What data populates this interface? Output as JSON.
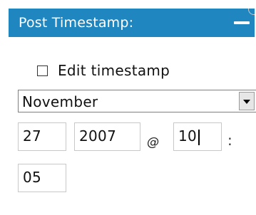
{
  "header": {
    "title": "Post Timestamp:",
    "collapse_icon": "minus-icon"
  },
  "timestamp": {
    "edit_checkbox_checked": false,
    "edit_label": "Edit timestamp",
    "month": {
      "selected": "November",
      "dropdown_icon": "chevron-down-icon"
    },
    "day": "27",
    "year": "2007",
    "at_separator": "@",
    "hour": "10",
    "time_separator": ":",
    "minute": "05"
  },
  "colors": {
    "header_bg": "#1f86c0",
    "header_text": "#ffffff",
    "field_border": "#c8c8c8"
  }
}
